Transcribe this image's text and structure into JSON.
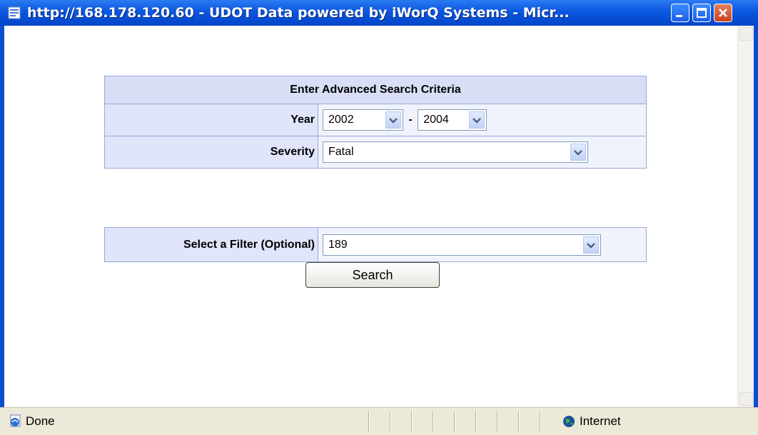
{
  "window": {
    "title": "http://168.178.120.60 - UDOT Data powered by iWorQ Systems - Micr...",
    "controls": [
      "minimize",
      "maximize",
      "close"
    ]
  },
  "form": {
    "heading": "Enter Advanced Search Criteria",
    "year_label": "Year",
    "year_from": "2002",
    "year_separator": "-",
    "year_to": "2004",
    "severity_label": "Severity",
    "severity_value": "Fatal",
    "filter_label": "Select a Filter (Optional)",
    "filter_value": "189",
    "search_button": "Search"
  },
  "statusbar": {
    "status": "Done",
    "zone": "Internet"
  },
  "colors": {
    "titlebar": "#0A56E0",
    "table_border": "#9AA6D8",
    "header_bg": "#D8DEF6"
  }
}
